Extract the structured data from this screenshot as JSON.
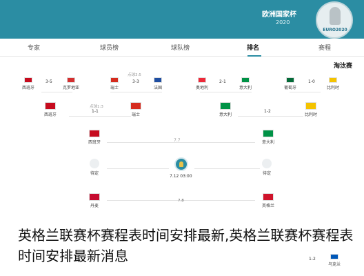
{
  "header": {
    "title": "欧洲国家杯",
    "year": "2020",
    "logo_text": "EURO2020"
  },
  "tabs": [
    {
      "label": "专家"
    },
    {
      "label": "球员榜"
    },
    {
      "label": "球队榜"
    },
    {
      "label": "排名",
      "active": true
    },
    {
      "label": "赛程"
    }
  ],
  "section_title": "淘汰赛",
  "bracket": {
    "r16": [
      {
        "team": "西班牙",
        "color": "#c60b1e"
      },
      {
        "team": "克罗地亚",
        "color": "#d32f2f"
      },
      {
        "team": "瑞士",
        "color": "#d52b1e"
      },
      {
        "team": "法国",
        "color": "#1f4ea1"
      },
      {
        "team": "奥地利",
        "color": "#ed2939"
      },
      {
        "team": "意大利",
        "color": "#009246"
      },
      {
        "team": "葡萄牙",
        "color": "#046a38"
      },
      {
        "team": "比利时",
        "color": "#f4c300"
      }
    ],
    "r16_scores": [
      "3-5",
      "3-3",
      "2-1",
      "1-0"
    ],
    "r16_meta": [
      "点球3:5"
    ],
    "qf": [
      {
        "team": "西班牙",
        "color": "#c60b1e"
      },
      {
        "team": "瑞士",
        "color": "#d52b1e"
      },
      {
        "team": "意大利",
        "color": "#009246"
      },
      {
        "team": "比利时",
        "color": "#f4c300"
      }
    ],
    "qf_scores": [
      "1-1",
      "1-2"
    ],
    "qf_meta": [
      "点球1:3"
    ],
    "sf": [
      {
        "team": "西班牙",
        "color": "#c60b1e"
      },
      {
        "team": "意大利",
        "color": "#009246"
      }
    ],
    "sf_date": "7.7",
    "final": {
      "left": "待定",
      "right": "待定",
      "time": "7.12 03:00"
    },
    "lower_sf": [
      {
        "team": "丹麦",
        "color": "#c60c30"
      },
      {
        "team": "英格兰",
        "color": "#cf142b"
      }
    ],
    "lower_sf_date": "7.8",
    "bottom_row": [
      {
        "team": "乌克兰",
        "color": "#0057b7"
      }
    ],
    "bottom_score": "1-2"
  },
  "caption": "英格兰联赛杯赛程表时间安排最新,英格兰联赛杯赛程表时间安排最新消息"
}
